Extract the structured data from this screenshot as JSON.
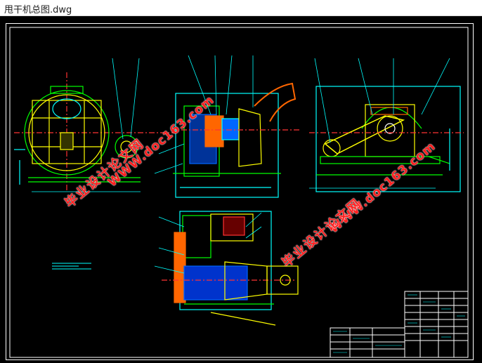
{
  "window": {
    "title": "甩干机总图.dwg"
  },
  "watermarks": {
    "url_text": "WWW.doc163.com",
    "cn_text": "毕业设计论文网",
    "color": "#ff1f1f"
  },
  "drawing": {
    "background": "#000000",
    "line_colors": {
      "frame": "#ffffff",
      "primary": "#00ff00",
      "secondary": "#00ffff",
      "detail": "#ffff00",
      "hidden": "#ff3333",
      "hatch": "#0066ff",
      "casing": "#ff6600"
    }
  }
}
